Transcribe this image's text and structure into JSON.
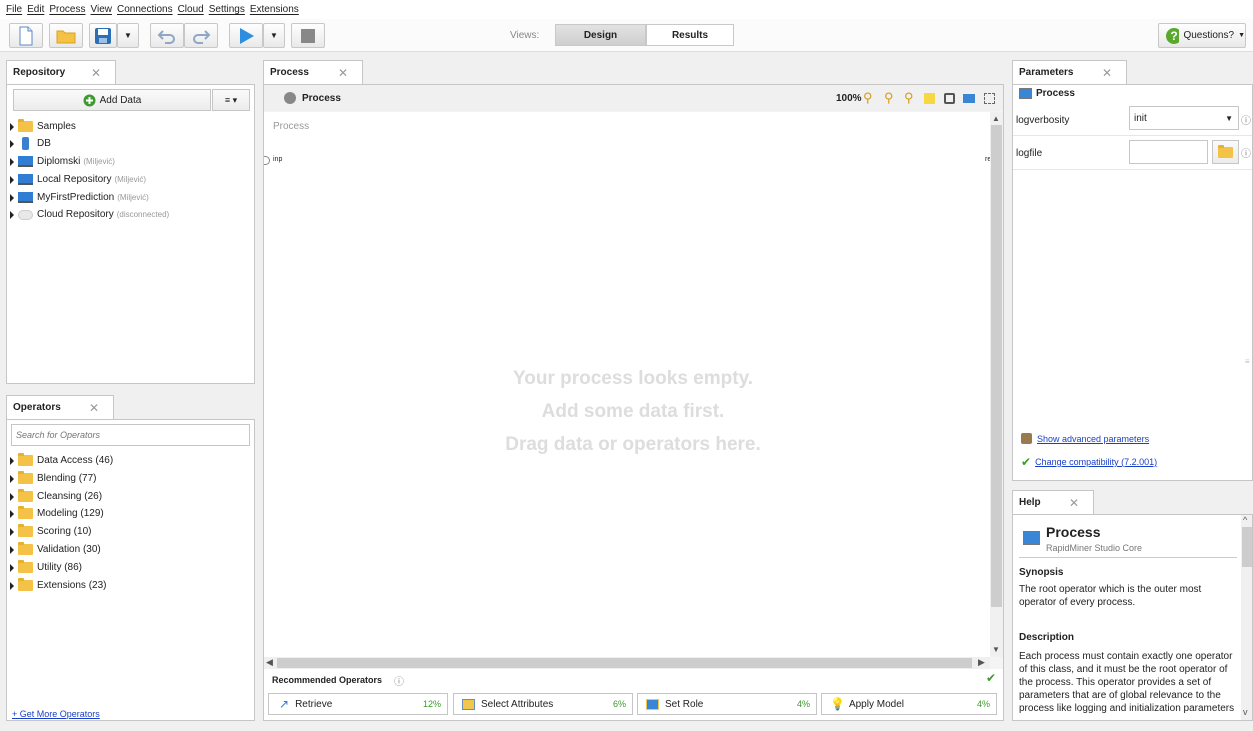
{
  "menu": [
    "File",
    "Edit",
    "Process",
    "View",
    "Connections",
    "Cloud",
    "Settings",
    "Extensions"
  ],
  "toolbar": {
    "views_label": "Views:",
    "design_label": "Design",
    "results_label": "Results",
    "questions_label": "Questions?"
  },
  "repository": {
    "tab_title": "Repository",
    "add_data_label": "Add Data",
    "items": [
      {
        "label": "Samples",
        "note": ""
      },
      {
        "label": "DB",
        "note": ""
      },
      {
        "label": "Diplomski",
        "note": "(Miljević)"
      },
      {
        "label": "Local Repository",
        "note": "(Miljević)"
      },
      {
        "label": "MyFirstPrediction",
        "note": "(Miljević)"
      },
      {
        "label": "Cloud Repository",
        "note": "(disconnected)"
      }
    ]
  },
  "operators": {
    "tab_title": "Operators",
    "search_placeholder": "Search for Operators",
    "items": [
      "Data Access (46)",
      "Blending (77)",
      "Cleansing (26)",
      "Modeling (129)",
      "Scoring (10)",
      "Validation (30)",
      "Utility (86)",
      "Extensions (23)"
    ],
    "get_more_label": "+ Get More Operators"
  },
  "process": {
    "tab_title": "Process",
    "header_title": "Process",
    "zoom": "100%",
    "canvas_label": "Process",
    "port_in": "inp",
    "port_out": "re",
    "empty_lines": [
      "Your process looks empty.",
      "Add some data first.",
      "Drag data or operators here."
    ],
    "recommended_title": "Recommended Operators",
    "recommended": [
      {
        "label": "Retrieve",
        "pct": "12%"
      },
      {
        "label": "Select Attributes",
        "pct": "6%"
      },
      {
        "label": "Set Role",
        "pct": "4%"
      },
      {
        "label": "Apply Model",
        "pct": "4%"
      }
    ]
  },
  "parameters": {
    "tab_title": "Parameters",
    "operator_name": "Process",
    "rows": [
      {
        "name": "logverbosity",
        "value": "init"
      },
      {
        "name": "logfile",
        "value": ""
      }
    ],
    "show_advanced_label": "Show advanced parameters",
    "change_compat_label": "Change compatibility (7.2.001)"
  },
  "help": {
    "tab_title": "Help",
    "title": "Process",
    "subtitle": "RapidMiner Studio Core",
    "synopsis_heading": "Synopsis",
    "synopsis_text": "The root operator which is the outer most operator of every process.",
    "description_heading": "Description",
    "description_text": "Each process must contain exactly one operator of this class, and it must be the root operator of the process. This operator provides a set of parameters that are of global relevance to the process like logging and initialization parameters"
  }
}
